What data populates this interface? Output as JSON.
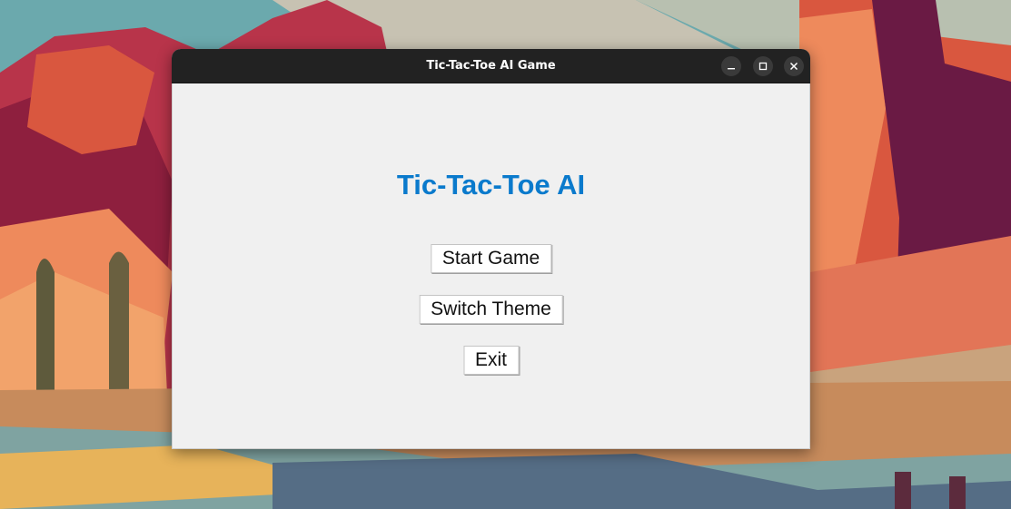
{
  "window": {
    "title": "Tic-Tac-Toe AI Game",
    "controls": [
      "minimize-icon",
      "maximize-icon",
      "close-icon"
    ]
  },
  "app": {
    "heading": "Tic-Tac-Toe AI",
    "heading_color": "#0a7acc",
    "buttons": {
      "start": "Start Game",
      "theme": "Switch Theme",
      "exit": "Exit"
    }
  },
  "wallpaper": {
    "description_colors": [
      "#5fa3a8",
      "#c24a45",
      "#ee8a5c",
      "#6a1a44"
    ]
  }
}
